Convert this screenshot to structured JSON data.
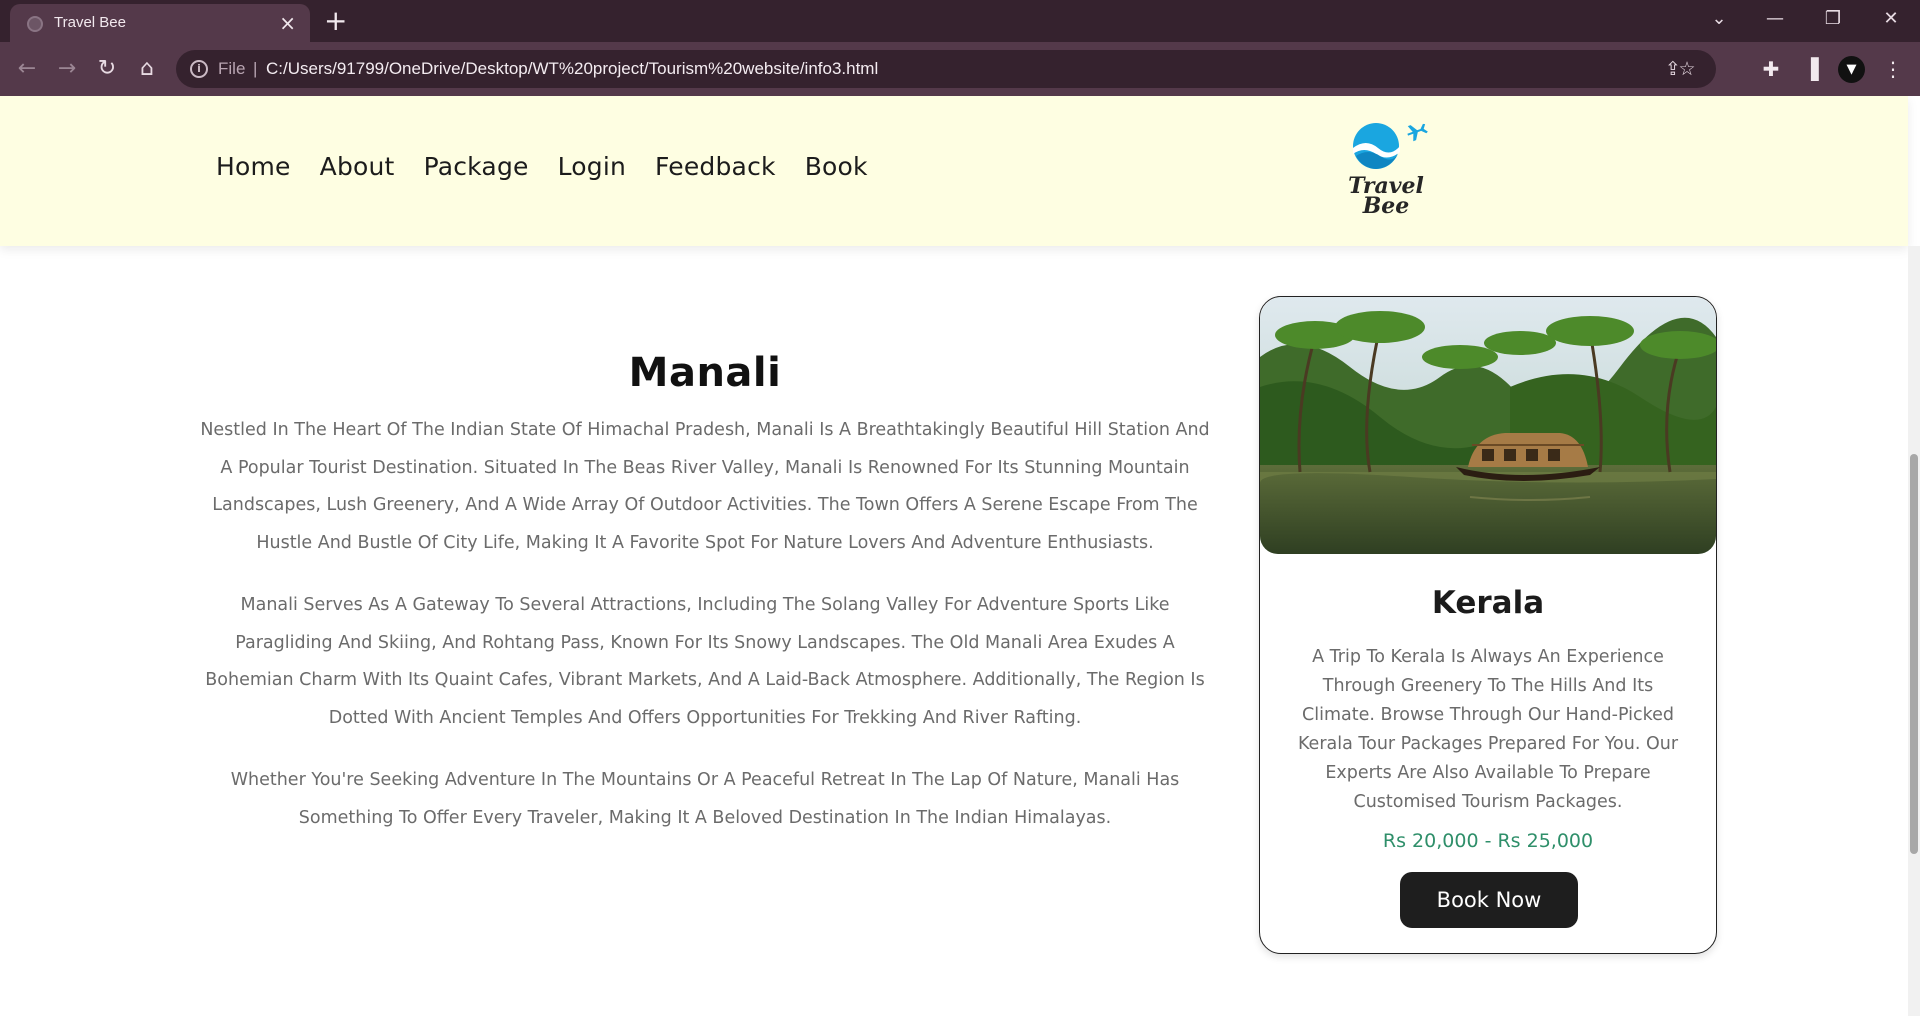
{
  "browser": {
    "tab_title": "Travel Bee",
    "tab_close": "×",
    "new_tab": "+",
    "url_scheme": "File",
    "url_separator": "|",
    "url": "C:/Users/91799/OneDrive/Desktop/WT%20project/Tourism%20website/info3.html",
    "controls": {
      "minimize": "—",
      "restore": "❐",
      "close": "✕",
      "tab_search": "⌄"
    }
  },
  "site": {
    "nav": [
      "Home",
      "About",
      "Package",
      "Login",
      "Feedback",
      "Book"
    ],
    "logo": {
      "line1": "Travel",
      "line2": "Bee"
    }
  },
  "article": {
    "title": "Manali",
    "paragraphs": [
      "Nestled In The Heart Of The Indian State Of Himachal Pradesh, Manali Is A Breathtakingly Beautiful Hill Station And A Popular Tourist Destination. Situated In The Beas River Valley, Manali Is Renowned For Its Stunning Mountain Landscapes, Lush Greenery, And A Wide Array Of Outdoor Activities. The Town Offers A Serene Escape From The Hustle And Bustle Of City Life, Making It A Favorite Spot For Nature Lovers And Adventure Enthusiasts.",
      "Manali Serves As A Gateway To Several Attractions, Including The Solang Valley For Adventure Sports Like Paragliding And Skiing, And Rohtang Pass, Known For Its Snowy Landscapes. The Old Manali Area Exudes A Bohemian Charm With Its Quaint Cafes, Vibrant Markets, And A Laid-Back Atmosphere. Additionally, The Region Is Dotted With Ancient Temples And Offers Opportunities For Trekking And River Rafting.",
      "Whether You're Seeking Adventure In The Mountains Or A Peaceful Retreat In The Lap Of Nature, Manali Has Something To Offer Every Traveler, Making It A Beloved Destination In The Indian Himalayas."
    ]
  },
  "card": {
    "title": "Kerala",
    "description": "A Trip To Kerala Is Always An Experience Through Greenery To The Hills And Its Climate. Browse Through Our Hand-Picked Kerala Tour Packages Prepared For You. Our Experts Are Also Available To Prepare Customised Tourism Packages.",
    "price": "Rs 20,000 - Rs 25,000",
    "button": "Book Now"
  },
  "colors": {
    "chrome_dark": "#35222e",
    "chrome_toolbar": "#54394a",
    "header_bg": "#fefee2",
    "price_green": "#2f8f6a",
    "button_bg": "#1e1e1e",
    "logo_blue": "#1aa6e0"
  }
}
